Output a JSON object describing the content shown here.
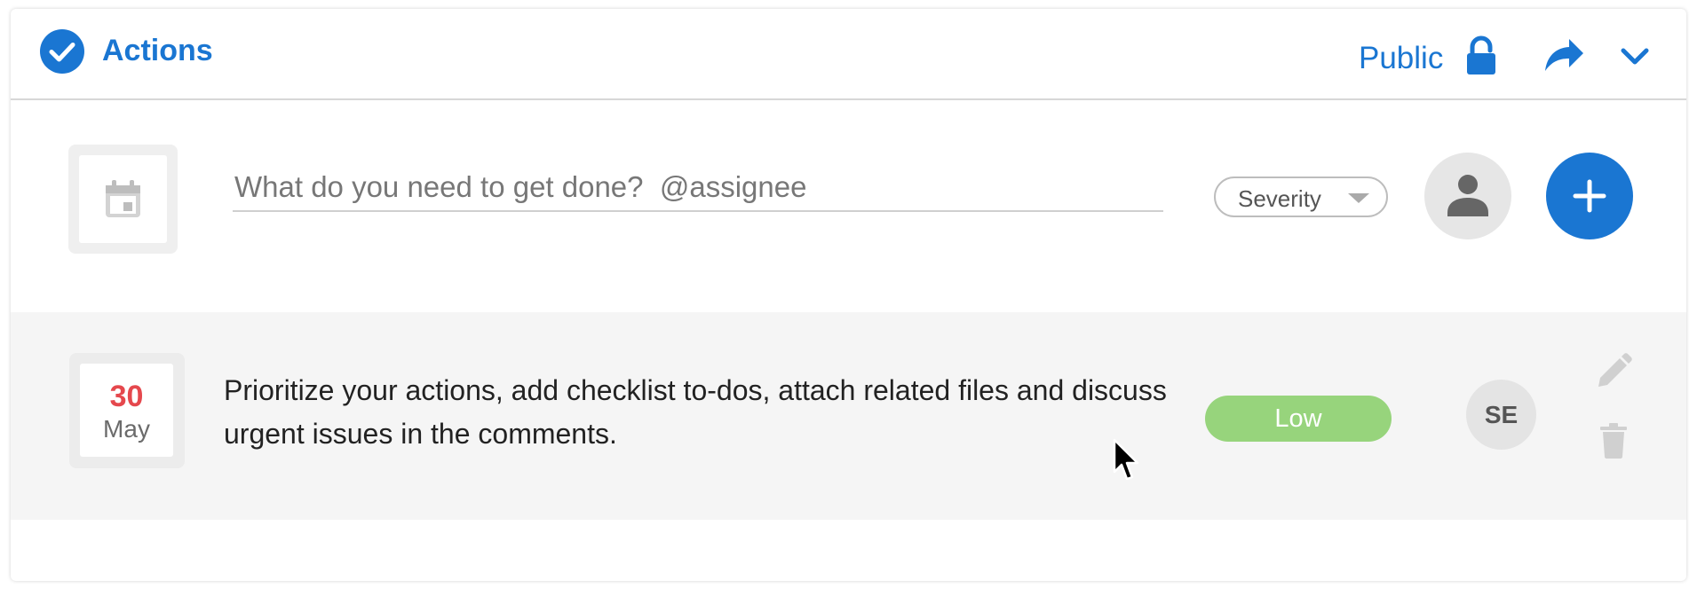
{
  "header": {
    "title": "Actions",
    "visibility_label": "Public",
    "check_icon": "check-circle-icon",
    "lock_icon": "unlock-icon",
    "share_icon": "share-arrow-icon",
    "collapse_icon": "chevron-down-icon"
  },
  "new_action": {
    "placeholder": "What do you need to get done?  @assignee",
    "value": "",
    "date_icon": "calendar-icon",
    "severity_label": "Severity",
    "assignee_icon": "person-icon",
    "add_icon": "plus-icon"
  },
  "actions": [
    {
      "due_day": "30",
      "due_month": "May",
      "text": "Prioritize your actions, add checklist to-dos, attach related files and discuss urgent issues in the comments.",
      "severity": "Low",
      "assignee_initials": "SE"
    }
  ],
  "colors": {
    "accent": "#1a76d2",
    "due_day": "#e5484d",
    "severity_low": "#97d47c",
    "row_background": "#f5f5f5"
  }
}
